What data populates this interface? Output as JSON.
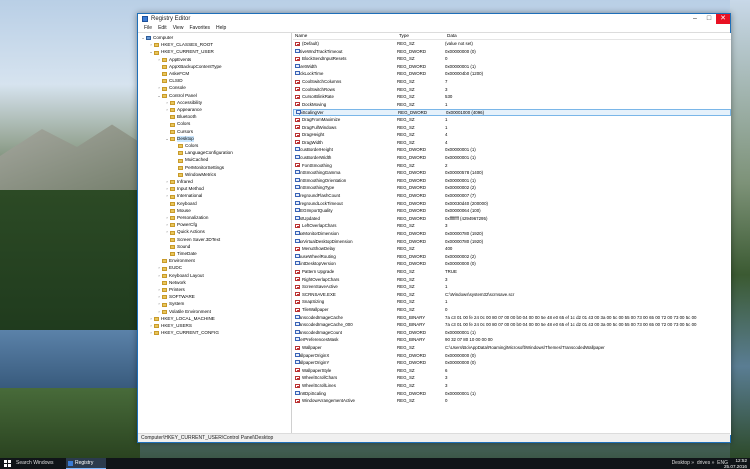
{
  "window": {
    "title": "Registry Editor"
  },
  "menu": [
    "File",
    "Edit",
    "View",
    "Favorites",
    "Help"
  ],
  "tree": [
    {
      "label": "Computer",
      "level": 0,
      "icon": "computer",
      "twisty": "v"
    },
    {
      "label": "HKEY_CLASSES_ROOT",
      "level": 1,
      "twisty": ">"
    },
    {
      "label": "HKEY_CURRENT_USER",
      "level": 1,
      "twisty": "v"
    },
    {
      "label": "AppEvents",
      "level": 2,
      "twisty": ">"
    },
    {
      "label": "AppXBackupContentType",
      "level": 2,
      "twisty": ""
    },
    {
      "label": "AskeFCM",
      "level": 2,
      "twisty": ""
    },
    {
      "label": "CLSID",
      "level": 2,
      "twisty": ""
    },
    {
      "label": "Console",
      "level": 2,
      "twisty": ">"
    },
    {
      "label": "Control Panel",
      "level": 2,
      "twisty": "v"
    },
    {
      "label": "Accessibility",
      "level": 3,
      "twisty": ">"
    },
    {
      "label": "Appearance",
      "level": 3,
      "twisty": ">"
    },
    {
      "label": "Bluetooth",
      "level": 3,
      "twisty": ""
    },
    {
      "label": "Colors",
      "level": 3,
      "twisty": ""
    },
    {
      "label": "Cursors",
      "level": 3,
      "twisty": ""
    },
    {
      "label": "Desktop",
      "level": 3,
      "twisty": "v",
      "selected": true
    },
    {
      "label": "Colors",
      "level": 4,
      "twisty": ""
    },
    {
      "label": "LanguageConfiguration",
      "level": 4,
      "twisty": ""
    },
    {
      "label": "MuiCached",
      "level": 4,
      "twisty": ""
    },
    {
      "label": "PerMonitorSettings",
      "level": 4,
      "twisty": ""
    },
    {
      "label": "WindowMetrics",
      "level": 4,
      "twisty": ""
    },
    {
      "label": "Infrared",
      "level": 3,
      "twisty": ">"
    },
    {
      "label": "Input Method",
      "level": 3,
      "twisty": ">"
    },
    {
      "label": "International",
      "level": 3,
      "twisty": ">"
    },
    {
      "label": "Keyboard",
      "level": 3,
      "twisty": ""
    },
    {
      "label": "Mouse",
      "level": 3,
      "twisty": ""
    },
    {
      "label": "Personalization",
      "level": 3,
      "twisty": ">"
    },
    {
      "label": "PowerCfg",
      "level": 3,
      "twisty": ">"
    },
    {
      "label": "Quick Actions",
      "level": 3,
      "twisty": ">"
    },
    {
      "label": "Screen Saver.3DText",
      "level": 3,
      "twisty": ""
    },
    {
      "label": "Sound",
      "level": 3,
      "twisty": ""
    },
    {
      "label": "TimeDate",
      "level": 3,
      "twisty": ""
    },
    {
      "label": "Environment",
      "level": 2,
      "twisty": ""
    },
    {
      "label": "EUDC",
      "level": 2,
      "twisty": ">"
    },
    {
      "label": "Keyboard Layout",
      "level": 2,
      "twisty": ">"
    },
    {
      "label": "Network",
      "level": 2,
      "twisty": ""
    },
    {
      "label": "Printers",
      "level": 2,
      "twisty": ">"
    },
    {
      "label": "SOFTWARE",
      "level": 2,
      "twisty": ">"
    },
    {
      "label": "System",
      "level": 2,
      "twisty": ">"
    },
    {
      "label": "Volatile Environment",
      "level": 2,
      "twisty": ">"
    },
    {
      "label": "HKEY_LOCAL_MACHINE",
      "level": 1,
      "twisty": ">"
    },
    {
      "label": "HKEY_USERS",
      "level": 1,
      "twisty": ">"
    },
    {
      "label": "HKEY_CURRENT_CONFIG",
      "level": 1,
      "twisty": ">"
    }
  ],
  "columns": [
    "Name",
    "Type",
    "Data"
  ],
  "values": [
    {
      "name": "(Default)",
      "type": "REG_SZ",
      "data": "(value not set)",
      "icon": "sz"
    },
    {
      "name": "ActiveWndTrackTimeout",
      "type": "REG_DWORD",
      "data": "0x00000000 (0)",
      "icon": "dw"
    },
    {
      "name": "BlockSendInputResets",
      "type": "REG_SZ",
      "data": "0",
      "icon": "sz"
    },
    {
      "name": "CaretWidth",
      "type": "REG_DWORD",
      "data": "0x00000001 (1)",
      "icon": "dw"
    },
    {
      "name": "ClickLockTime",
      "type": "REG_DWORD",
      "data": "0x000004b0 (1200)",
      "icon": "dw"
    },
    {
      "name": "CoolSwitchColumns",
      "type": "REG_SZ",
      "data": "7",
      "icon": "sz"
    },
    {
      "name": "CoolSwitchRows",
      "type": "REG_SZ",
      "data": "3",
      "icon": "sz"
    },
    {
      "name": "CursorBlinkRate",
      "type": "REG_SZ",
      "data": "530",
      "icon": "sz"
    },
    {
      "name": "DockMoving",
      "type": "REG_SZ",
      "data": "1",
      "icon": "sz"
    },
    {
      "name": "DpiScalingVer",
      "type": "REG_DWORD",
      "data": "0x00001000 (4096)",
      "icon": "dw",
      "selected": true
    },
    {
      "name": "DragFromMaximize",
      "type": "REG_SZ",
      "data": "1",
      "icon": "sz"
    },
    {
      "name": "DragFullWindows",
      "type": "REG_SZ",
      "data": "1",
      "icon": "sz"
    },
    {
      "name": "DragHeight",
      "type": "REG_SZ",
      "data": "4",
      "icon": "sz"
    },
    {
      "name": "DragWidth",
      "type": "REG_SZ",
      "data": "4",
      "icon": "sz"
    },
    {
      "name": "FocusBorderHeight",
      "type": "REG_DWORD",
      "data": "0x00000001 (1)",
      "icon": "dw"
    },
    {
      "name": "FocusBorderWidth",
      "type": "REG_DWORD",
      "data": "0x00000001 (1)",
      "icon": "dw"
    },
    {
      "name": "FontSmoothing",
      "type": "REG_SZ",
      "data": "2",
      "icon": "sz"
    },
    {
      "name": "FontSmoothingGamma",
      "type": "REG_DWORD",
      "data": "0x00000578 (1400)",
      "icon": "dw"
    },
    {
      "name": "FontSmoothingOrientation",
      "type": "REG_DWORD",
      "data": "0x00000001 (1)",
      "icon": "dw"
    },
    {
      "name": "FontSmoothingType",
      "type": "REG_DWORD",
      "data": "0x00000002 (2)",
      "icon": "dw"
    },
    {
      "name": "ForegroundFlashCount",
      "type": "REG_DWORD",
      "data": "0x00000007 (7)",
      "icon": "dw"
    },
    {
      "name": "ForegroundLockTimeout",
      "type": "REG_DWORD",
      "data": "0x00030d40 (200000)",
      "icon": "dw"
    },
    {
      "name": "JPEGImportQuality",
      "type": "REG_DWORD",
      "data": "0x00000064 (100)",
      "icon": "dw"
    },
    {
      "name": "LastUpdated",
      "type": "REG_DWORD",
      "data": "0xffffffff (4294967295)",
      "icon": "dw"
    },
    {
      "name": "LeftOverlapChars",
      "type": "REG_SZ",
      "data": "3",
      "icon": "sz"
    },
    {
      "name": "MaxMonitorDimension",
      "type": "REG_DWORD",
      "data": "0x00000780 (1920)",
      "icon": "dw"
    },
    {
      "name": "MaxVirtualDesktopDimension",
      "type": "REG_DWORD",
      "data": "0x00000780 (1920)",
      "icon": "dw"
    },
    {
      "name": "MenuShowDelay",
      "type": "REG_SZ",
      "data": "400",
      "icon": "sz"
    },
    {
      "name": "MouseWheelRouting",
      "type": "REG_DWORD",
      "data": "0x00000002 (2)",
      "icon": "dw"
    },
    {
      "name": "PaintDesktopVersion",
      "type": "REG_DWORD",
      "data": "0x00000000 (0)",
      "icon": "dw"
    },
    {
      "name": "Pattern Upgrade",
      "type": "REG_SZ",
      "data": "TRUE",
      "icon": "sz"
    },
    {
      "name": "RightOverlapChars",
      "type": "REG_SZ",
      "data": "3",
      "icon": "sz"
    },
    {
      "name": "ScreenSaveActive",
      "type": "REG_SZ",
      "data": "1",
      "icon": "sz"
    },
    {
      "name": "SCRNSAVE.EXE",
      "type": "REG_SZ",
      "data": "C:\\Windows\\system32\\scrnsave.scr",
      "icon": "sz"
    },
    {
      "name": "SnapSizing",
      "type": "REG_SZ",
      "data": "1",
      "icon": "sz"
    },
    {
      "name": "TileWallpaper",
      "type": "REG_SZ",
      "data": "0",
      "icon": "sz"
    },
    {
      "name": "TranscodedImageCache",
      "type": "REG_BINARY",
      "data": "7a c3 01 00 fe 24 0c 00 80 07 00 00 b0 04 00 00 5e 48 e0 65 ef 1c d2 01 43 00 3a 00 5c 00 55 00 73 00 65 00 72 00 73 00 5c 00",
      "icon": "bi"
    },
    {
      "name": "TranscodedImageCache_000",
      "type": "REG_BINARY",
      "data": "7a c3 01 00 fe 24 0c 00 80 07 00 00 b0 04 00 00 5e 48 e0 65 ef 1c d2 01 43 00 3a 00 5c 00 55 00 73 00 65 00 72 00 73 00 5c 00",
      "icon": "bi"
    },
    {
      "name": "TranscodedImageCount",
      "type": "REG_DWORD",
      "data": "0x00000001 (1)",
      "icon": "dw"
    },
    {
      "name": "UserPreferencesMask",
      "type": "REG_BINARY",
      "data": "90 32 07 80 10 00 00 00",
      "icon": "bi"
    },
    {
      "name": "Wallpaper",
      "type": "REG_SZ",
      "data": "C:\\Users\\Bo\\AppData\\Roaming\\Microsoft\\Windows\\Themes\\TranscodedWallpaper",
      "icon": "sz"
    },
    {
      "name": "WallpaperOriginX",
      "type": "REG_DWORD",
      "data": "0x00000000 (0)",
      "icon": "dw"
    },
    {
      "name": "WallpaperOriginY",
      "type": "REG_DWORD",
      "data": "0x00000000 (0)",
      "icon": "dw"
    },
    {
      "name": "WallpaperStyle",
      "type": "REG_SZ",
      "data": "6",
      "icon": "sz"
    },
    {
      "name": "WheelScrollChars",
      "type": "REG_SZ",
      "data": "3",
      "icon": "sz"
    },
    {
      "name": "WheelScrollLines",
      "type": "REG_SZ",
      "data": "3",
      "icon": "sz"
    },
    {
      "name": "Win8DpiScaling",
      "type": "REG_DWORD",
      "data": "0x00000001 (1)",
      "icon": "dw"
    },
    {
      "name": "WindowArrangementActive",
      "type": "REG_SZ",
      "data": "0",
      "icon": "sz"
    }
  ],
  "status": {
    "path": "Computer\\HKEY_CURRENT_USER\\Control Panel\\Desktop"
  },
  "taskbar": {
    "search_label": "Search Windows",
    "active_app": "Registry Editor",
    "tray_desktop": "Desktop",
    "tray_drives": "drives",
    "tray_lang": "ENG",
    "clock_time": "12:52",
    "clock_date": "25.07.2016"
  }
}
